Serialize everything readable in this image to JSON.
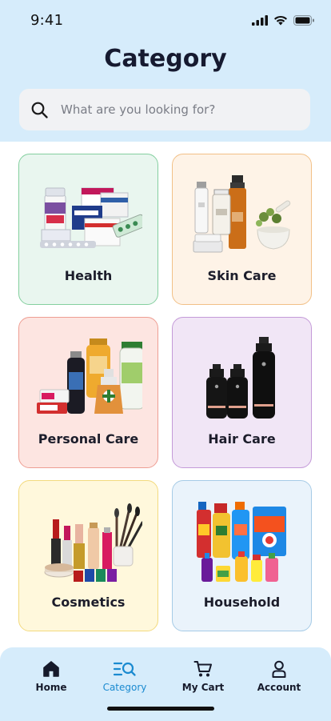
{
  "status_bar": {
    "time": "9:41"
  },
  "page": {
    "title": "Category"
  },
  "search": {
    "placeholder": "What are you looking for?",
    "icon": "search-icon"
  },
  "categories": [
    {
      "label": "Health",
      "accent": "#84cf9f",
      "background": "#e9f6ef"
    },
    {
      "label": "Skin Care",
      "accent": "#f2c087",
      "background": "#fef3e7"
    },
    {
      "label": "Personal Care",
      "accent": "#ee9e93",
      "background": "#fde5e1"
    },
    {
      "label": "Hair Care",
      "accent": "#c49ad8",
      "background": "#f1e6f6"
    },
    {
      "label": "Cosmetics",
      "accent": "#f3da7e",
      "background": "#fff8dc"
    },
    {
      "label": "Household",
      "accent": "#a6cbe6",
      "background": "#eaf3fb"
    }
  ],
  "tabbar": {
    "items": [
      {
        "label": "Home",
        "icon": "home-icon",
        "active": false
      },
      {
        "label": "Category",
        "icon": "category-icon",
        "active": true
      },
      {
        "label": "My Cart",
        "icon": "cart-icon",
        "active": false
      },
      {
        "label": "Account",
        "icon": "account-icon",
        "active": false
      }
    ],
    "active_color": "#1a8ad0"
  }
}
